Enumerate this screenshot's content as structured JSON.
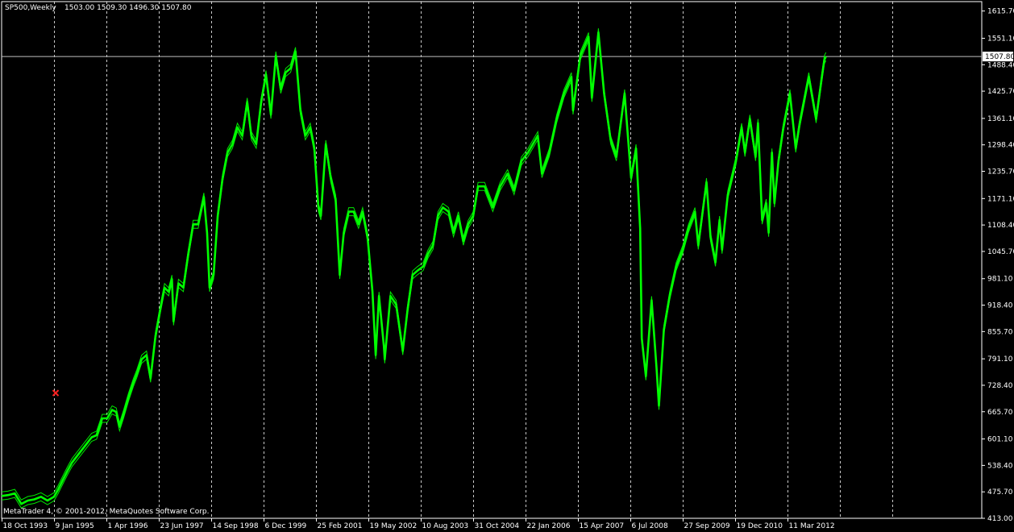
{
  "header": {
    "symbol": "SP500,Weekly",
    "ohlc": "1503.00 1509.30 1496.30 1507.80"
  },
  "footer": {
    "copyright": "MetaTrader 4, © 2001-2012, MetaQuotes Software Corp."
  },
  "colors": {
    "background": "#000000",
    "series": "#00ff00",
    "grid": "#c8c8c8",
    "text": "#ffffff",
    "marker": "#ff2020"
  },
  "chart_data": {
    "type": "line",
    "title": "",
    "xlabel": "",
    "ylabel": "",
    "ylim": [
      413.0,
      1638.0
    ],
    "grid": true,
    "y_ticks": [
      "1615.70",
      "1551.10",
      "1488.40",
      "1425.70",
      "1361.10",
      "1298.40",
      "1235.70",
      "1171.10",
      "1108.40",
      "1045.70",
      "981.10",
      "918.40",
      "855.70",
      "791.10",
      "728.40",
      "665.70",
      "601.10",
      "538.40",
      "475.70",
      "413.00"
    ],
    "x_ticks": [
      "18 Oct 1993",
      "9 Jan 1995",
      "1 Apr 1996",
      "23 Jun 1997",
      "14 Sep 1998",
      "6 Dec 1999",
      "25 Feb 2001",
      "19 May 2002",
      "10 Aug 2003",
      "31 Oct 2004",
      "22 Jan 2006",
      "15 Apr 2007",
      "6 Jul 2008",
      "27 Sep 2009",
      "19 Dec 2010",
      "11 Mar 2012"
    ],
    "current_price": "1507.80",
    "current_price_value": 1507.8,
    "marker": {
      "x": "1995-01-23",
      "y": 710
    },
    "series": [
      {
        "values": [
          [
            "1993-10-18",
            466
          ],
          [
            "1993-12-13",
            468
          ],
          [
            "1994-02-07",
            472
          ],
          [
            "1994-04-04",
            447
          ],
          [
            "1994-05-30",
            455
          ],
          [
            "1994-07-25",
            458
          ],
          [
            "1994-09-19",
            464
          ],
          [
            "1994-11-14",
            455
          ],
          [
            "1995-01-09",
            464
          ],
          [
            "1995-02-13",
            481
          ],
          [
            "1995-03-20",
            501
          ],
          [
            "1995-05-01",
            524
          ],
          [
            "1995-06-12",
            545
          ],
          [
            "1995-07-24",
            560
          ],
          [
            "1995-09-04",
            575
          ],
          [
            "1995-10-16",
            590
          ],
          [
            "1995-11-27",
            605
          ],
          [
            "1996-01-08",
            610
          ],
          [
            "1996-02-26",
            650
          ],
          [
            "1996-04-08",
            650
          ],
          [
            "1996-05-20",
            670
          ],
          [
            "1996-06-24",
            665
          ],
          [
            "1996-07-22",
            630
          ],
          [
            "1996-08-26",
            660
          ],
          [
            "1996-10-07",
            700
          ],
          [
            "1996-11-18",
            735
          ],
          [
            "1996-12-16",
            755
          ],
          [
            "1997-01-27",
            790
          ],
          [
            "1997-03-10",
            800
          ],
          [
            "1997-04-14",
            745
          ],
          [
            "1997-05-26",
            845
          ],
          [
            "1997-07-07",
            910
          ],
          [
            "1997-08-11",
            960
          ],
          [
            "1997-09-15",
            950
          ],
          [
            "1997-10-13",
            980
          ],
          [
            "1997-10-27",
            880
          ],
          [
            "1997-12-08",
            970
          ],
          [
            "1998-01-19",
            960
          ],
          [
            "1998-03-02",
            1040
          ],
          [
            "1998-04-13",
            1110
          ],
          [
            "1998-05-25",
            1110
          ],
          [
            "1998-07-13",
            1175
          ],
          [
            "1998-08-10",
            1090
          ],
          [
            "1998-08-31",
            960
          ],
          [
            "1998-10-05",
            990
          ],
          [
            "1998-11-09",
            1130
          ],
          [
            "1998-12-21",
            1220
          ],
          [
            "1999-02-01",
            1280
          ],
          [
            "1999-03-15",
            1300
          ],
          [
            "1999-04-26",
            1340
          ],
          [
            "1999-06-07",
            1320
          ],
          [
            "1999-07-19",
            1400
          ],
          [
            "1999-08-23",
            1320
          ],
          [
            "1999-10-04",
            1300
          ],
          [
            "1999-11-15",
            1400
          ],
          [
            "1999-12-27",
            1465
          ],
          [
            "2000-02-07",
            1370
          ],
          [
            "2000-03-20",
            1510
          ],
          [
            "2000-05-01",
            1430
          ],
          [
            "2000-06-12",
            1470
          ],
          [
            "2000-07-24",
            1480
          ],
          [
            "2000-09-04",
            1520
          ],
          [
            "2000-10-16",
            1380
          ],
          [
            "2000-11-27",
            1320
          ],
          [
            "2001-01-08",
            1340
          ],
          [
            "2001-02-12",
            1290
          ],
          [
            "2001-03-19",
            1150
          ],
          [
            "2001-04-09",
            1130
          ],
          [
            "2001-05-21",
            1300
          ],
          [
            "2001-07-02",
            1220
          ],
          [
            "2001-08-13",
            1170
          ],
          [
            "2001-09-17",
            990
          ],
          [
            "2001-10-22",
            1090
          ],
          [
            "2001-12-03",
            1140
          ],
          [
            "2002-01-14",
            1140
          ],
          [
            "2002-02-25",
            1110
          ],
          [
            "2002-04-01",
            1140
          ],
          [
            "2002-05-13",
            1080
          ],
          [
            "2002-06-24",
            950
          ],
          [
            "2002-07-22",
            800
          ],
          [
            "2002-08-19",
            940
          ],
          [
            "2002-09-30",
            820
          ],
          [
            "2002-10-07",
            790
          ],
          [
            "2002-11-25",
            940
          ],
          [
            "2003-01-13",
            920
          ],
          [
            "2003-03-10",
            810
          ],
          [
            "2003-04-21",
            910
          ],
          [
            "2003-06-02",
            990
          ],
          [
            "2003-07-14",
            1000
          ],
          [
            "2003-09-01",
            1010
          ],
          [
            "2003-10-13",
            1040
          ],
          [
            "2003-11-24",
            1060
          ],
          [
            "2004-01-05",
            1130
          ],
          [
            "2004-02-16",
            1150
          ],
          [
            "2004-04-05",
            1140
          ],
          [
            "2004-05-17",
            1090
          ],
          [
            "2004-06-28",
            1130
          ],
          [
            "2004-08-09",
            1070
          ],
          [
            "2004-09-20",
            1110
          ],
          [
            "2004-11-01",
            1130
          ],
          [
            "2004-12-13",
            1200
          ],
          [
            "2005-02-07",
            1200
          ],
          [
            "2005-04-18",
            1150
          ],
          [
            "2005-06-20",
            1200
          ],
          [
            "2005-08-22",
            1230
          ],
          [
            "2005-10-17",
            1190
          ],
          [
            "2005-12-19",
            1260
          ],
          [
            "2006-02-13",
            1280
          ],
          [
            "2006-05-08",
            1320
          ],
          [
            "2006-06-12",
            1230
          ],
          [
            "2006-08-14",
            1280
          ],
          [
            "2006-10-16",
            1360
          ],
          [
            "2006-12-18",
            1420
          ],
          [
            "2007-02-19",
            1460
          ],
          [
            "2007-03-05",
            1380
          ],
          [
            "2007-05-07",
            1510
          ],
          [
            "2007-07-16",
            1555
          ],
          [
            "2007-08-13",
            1410
          ],
          [
            "2007-10-08",
            1565
          ],
          [
            "2007-11-26",
            1420
          ],
          [
            "2008-01-21",
            1310
          ],
          [
            "2008-03-10",
            1270
          ],
          [
            "2008-05-19",
            1420
          ],
          [
            "2008-07-14",
            1220
          ],
          [
            "2008-08-25",
            1290
          ],
          [
            "2008-09-29",
            1100
          ],
          [
            "2008-10-13",
            840
          ],
          [
            "2008-11-17",
            750
          ],
          [
            "2009-01-05",
            930
          ],
          [
            "2009-02-16",
            770
          ],
          [
            "2009-03-09",
            680
          ],
          [
            "2009-04-20",
            860
          ],
          [
            "2009-06-08",
            940
          ],
          [
            "2009-08-03",
            1010
          ],
          [
            "2009-09-28",
            1050
          ],
          [
            "2009-11-16",
            1100
          ],
          [
            "2010-01-11",
            1140
          ],
          [
            "2010-02-08",
            1060
          ],
          [
            "2010-04-19",
            1210
          ],
          [
            "2010-05-24",
            1080
          ],
          [
            "2010-07-05",
            1020
          ],
          [
            "2010-08-09",
            1120
          ],
          [
            "2010-08-30",
            1050
          ],
          [
            "2010-10-18",
            1180
          ],
          [
            "2010-12-27",
            1260
          ],
          [
            "2011-02-14",
            1340
          ],
          [
            "2011-03-14",
            1280
          ],
          [
            "2011-04-25",
            1360
          ],
          [
            "2011-06-13",
            1270
          ],
          [
            "2011-07-04",
            1350
          ],
          [
            "2011-08-08",
            1120
          ],
          [
            "2011-09-12",
            1160
          ],
          [
            "2011-10-03",
            1090
          ],
          [
            "2011-10-31",
            1280
          ],
          [
            "2011-11-21",
            1160
          ],
          [
            "2011-12-26",
            1260
          ],
          [
            "2012-02-06",
            1340
          ],
          [
            "2012-04-02",
            1420
          ],
          [
            "2012-05-21",
            1290
          ],
          [
            "2012-06-25",
            1350
          ],
          [
            "2012-09-10",
            1460
          ],
          [
            "2012-11-12",
            1360
          ],
          [
            "2012-12-31",
            1460
          ],
          [
            "2013-01-21",
            1500
          ],
          [
            "2013-02-04",
            1507.8
          ]
        ]
      }
    ]
  }
}
